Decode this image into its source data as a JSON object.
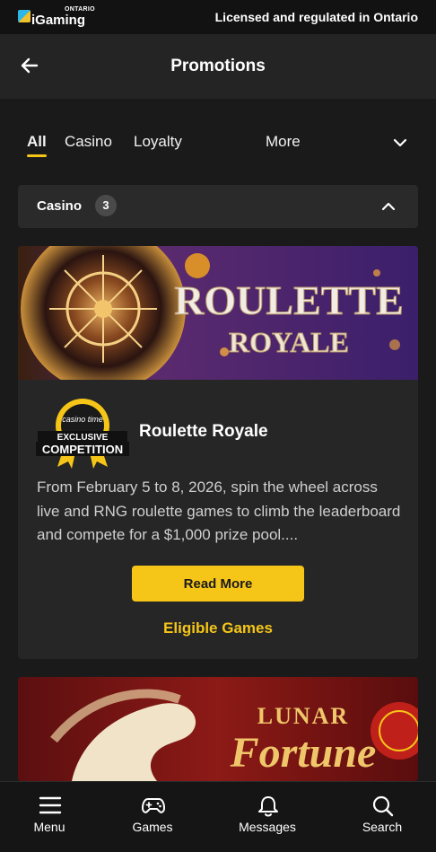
{
  "topbar": {
    "brand_region": "ONTARIO",
    "brand_name": "iGaming",
    "licensed_text": "Licensed and regulated in Ontario"
  },
  "header": {
    "title": "Promotions"
  },
  "tabs": [
    {
      "label": "All",
      "active": true
    },
    {
      "label": "Casino"
    },
    {
      "label": "Loyalty"
    },
    {
      "label": "More"
    }
  ],
  "section": {
    "label": "Casino",
    "count": "3"
  },
  "promo": {
    "banner_line1": "ROULETTE",
    "banner_line2": "ROYALE",
    "badge_brand": "casino time",
    "badge_line1": "EXCLUSIVE",
    "badge_line2": "COMPETITION",
    "title": "Roulette Royale",
    "description": "From February 5 to 8, 2026, spin the wheel across live and RNG roulette games to climb the leaderboard and compete for a $1,000 prize pool....",
    "read_more_label": "Read More",
    "eligible_label": "Eligible Games"
  },
  "promo2": {
    "banner_line1": "LUNAR",
    "banner_line2": "Fortune"
  },
  "bottom_nav": [
    {
      "label": "Menu",
      "icon": "menu-icon"
    },
    {
      "label": "Games",
      "icon": "gamepad-icon"
    },
    {
      "label": "Messages",
      "icon": "bell-icon"
    },
    {
      "label": "Search",
      "icon": "search-icon"
    }
  ],
  "colors": {
    "accent": "#f5c518",
    "background": "#1a1a1a",
    "card": "#262626"
  }
}
